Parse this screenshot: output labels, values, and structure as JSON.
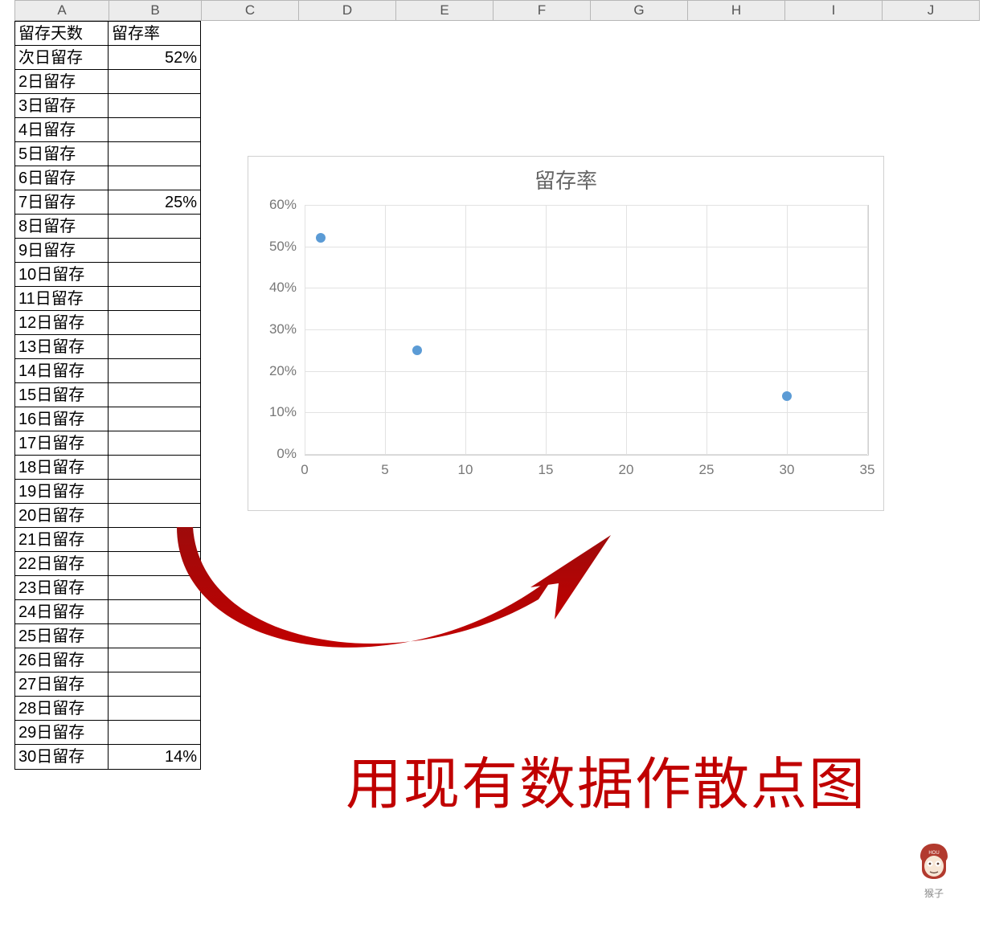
{
  "columns": [
    "A",
    "B",
    "C",
    "D",
    "E",
    "F",
    "G",
    "H",
    "I",
    "J"
  ],
  "headerRow": {
    "A": "留存天数",
    "B": "留存率"
  },
  "rows": [
    {
      "A": "次日留存",
      "B": "52%"
    },
    {
      "A": "2日留存",
      "B": ""
    },
    {
      "A": "3日留存",
      "B": ""
    },
    {
      "A": "4日留存",
      "B": ""
    },
    {
      "A": "5日留存",
      "B": ""
    },
    {
      "A": "6日留存",
      "B": ""
    },
    {
      "A": "7日留存",
      "B": "25%"
    },
    {
      "A": "8日留存",
      "B": ""
    },
    {
      "A": "9日留存",
      "B": ""
    },
    {
      "A": "10日留存",
      "B": ""
    },
    {
      "A": "11日留存",
      "B": ""
    },
    {
      "A": "12日留存",
      "B": ""
    },
    {
      "A": "13日留存",
      "B": ""
    },
    {
      "A": "14日留存",
      "B": ""
    },
    {
      "A": "15日留存",
      "B": ""
    },
    {
      "A": "16日留存",
      "B": ""
    },
    {
      "A": "17日留存",
      "B": ""
    },
    {
      "A": "18日留存",
      "B": ""
    },
    {
      "A": "19日留存",
      "B": ""
    },
    {
      "A": "20日留存",
      "B": ""
    },
    {
      "A": "21日留存",
      "B": ""
    },
    {
      "A": "22日留存",
      "B": ""
    },
    {
      "A": "23日留存",
      "B": ""
    },
    {
      "A": "24日留存",
      "B": ""
    },
    {
      "A": "25日留存",
      "B": ""
    },
    {
      "A": "26日留存",
      "B": ""
    },
    {
      "A": "27日留存",
      "B": ""
    },
    {
      "A": "28日留存",
      "B": ""
    },
    {
      "A": "29日留存",
      "B": ""
    },
    {
      "A": "30日留存",
      "B": "14%"
    }
  ],
  "caption": "用现有数据作散点图",
  "watermark": {
    "label": "猴子"
  },
  "chart_data": {
    "type": "scatter",
    "title": "留存率",
    "xlabel": "",
    "ylabel": "",
    "xlim": [
      0,
      35
    ],
    "ylim": [
      0,
      0.6
    ],
    "xticks": [
      0,
      5,
      10,
      15,
      20,
      25,
      30,
      35
    ],
    "xtick_labels": [
      "0",
      "5",
      "10",
      "15",
      "20",
      "25",
      "30",
      "35"
    ],
    "yticks": [
      0,
      0.1,
      0.2,
      0.3,
      0.4,
      0.5,
      0.6
    ],
    "ytick_labels": [
      "0%",
      "10%",
      "20%",
      "30%",
      "40%",
      "50%",
      "60%"
    ],
    "series": [
      {
        "name": "留存率",
        "points": [
          {
            "x": 1,
            "y": 0.52
          },
          {
            "x": 7,
            "y": 0.25
          },
          {
            "x": 30,
            "y": 0.14
          }
        ]
      }
    ]
  }
}
